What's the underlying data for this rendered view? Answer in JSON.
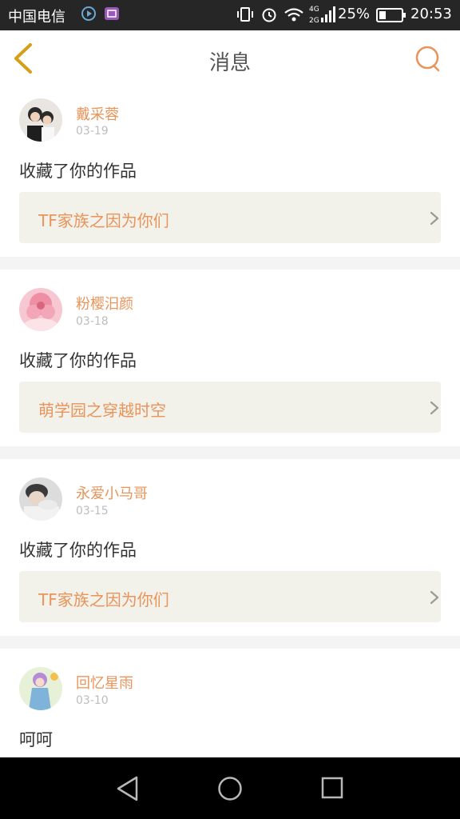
{
  "status_bar": {
    "carrier": "中国电信",
    "network_label": "4G 2G",
    "battery_percent": "25%",
    "time": "20:53"
  },
  "header": {
    "title": "消息"
  },
  "messages": [
    {
      "user": "戴采蓉",
      "date": "03-19",
      "action": "收藏了你的作品",
      "work": "TF家族之因为你们"
    },
    {
      "user": "粉樱汨颜",
      "date": "03-18",
      "action": "收藏了你的作品",
      "work": "萌学园之穿越时空"
    },
    {
      "user": "永爱小马哥",
      "date": "03-15",
      "action": "收藏了你的作品",
      "work": "TF家族之因为你们"
    },
    {
      "user": "回忆星雨",
      "date": "03-10",
      "action": "呵呵"
    }
  ],
  "colors": {
    "accent": "#e8945a",
    "back_icon": "#d4a017",
    "card_link_bg": "#f2f1ea",
    "status_bar_bg": "#262626"
  },
  "icons": {
    "back": "chevron-left-icon",
    "search": "search-icon",
    "link": "chevron-right-icon",
    "nav_back": "triangle-back-icon",
    "nav_home": "circle-home-icon",
    "nav_recent": "square-recents-icon"
  }
}
